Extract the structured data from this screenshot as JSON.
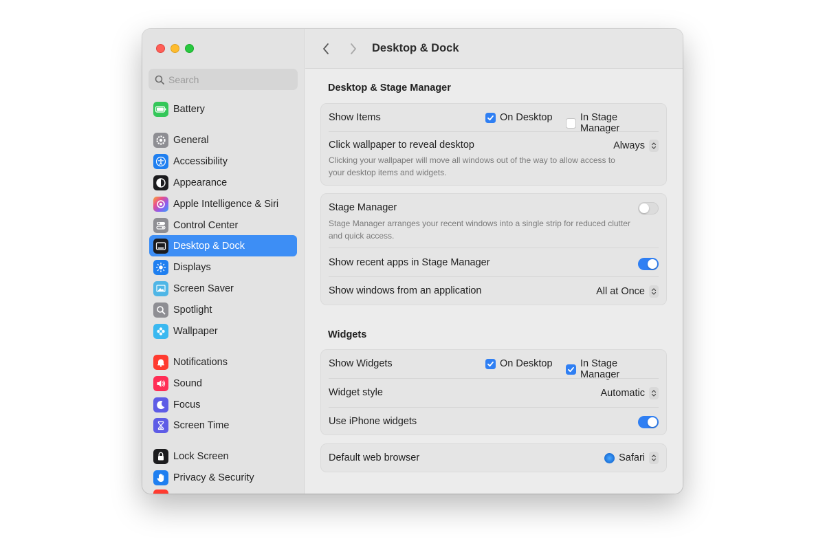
{
  "toolbar": {
    "title": "Desktop & Dock"
  },
  "search": {
    "placeholder": "Search"
  },
  "sidebar": {
    "items": [
      {
        "label": "Battery",
        "icon": "battery-icon",
        "color": "#34c759"
      },
      {
        "label": "General",
        "icon": "gear-icon",
        "color": "#8e8e93"
      },
      {
        "label": "Accessibility",
        "icon": "accessibility-icon",
        "color": "#1f7ff0"
      },
      {
        "label": "Appearance",
        "icon": "appearance-icon",
        "color": "#1c1c1e"
      },
      {
        "label": "Apple Intelligence & Siri",
        "icon": "siri-icon",
        "color": "#c86dd7"
      },
      {
        "label": "Control Center",
        "icon": "control-center-icon",
        "color": "#8e8e93"
      },
      {
        "label": "Desktop & Dock",
        "icon": "dock-icon",
        "color": "#1c1c1e",
        "selected": true
      },
      {
        "label": "Displays",
        "icon": "displays-icon",
        "color": "#1f7ff0"
      },
      {
        "label": "Screen Saver",
        "icon": "screen-saver-icon",
        "color": "#4fb6e6"
      },
      {
        "label": "Spotlight",
        "icon": "spotlight-icon",
        "color": "#8e8e93"
      },
      {
        "label": "Wallpaper",
        "icon": "wallpaper-icon",
        "color": "#3ab8f0"
      },
      {
        "label": "Notifications",
        "icon": "notifications-icon",
        "color": "#ff3b30"
      },
      {
        "label": "Sound",
        "icon": "sound-icon",
        "color": "#ff2d55"
      },
      {
        "label": "Focus",
        "icon": "focus-icon",
        "color": "#5e5ce6"
      },
      {
        "label": "Screen Time",
        "icon": "screen-time-icon",
        "color": "#5e5ce6"
      },
      {
        "label": "Lock Screen",
        "icon": "lock-icon",
        "color": "#1c1c1e"
      },
      {
        "label": "Privacy & Security",
        "icon": "hand-icon",
        "color": "#1f7ff0"
      }
    ]
  },
  "desktop_stage": {
    "title": "Desktop & Stage Manager",
    "show_items": {
      "label": "Show Items",
      "on_desktop": "On Desktop",
      "in_stage_manager": "In Stage Manager",
      "on_desktop_checked": true,
      "in_stage_manager_checked": false
    },
    "click_wallpaper": {
      "label": "Click wallpaper to reveal desktop",
      "value": "Always",
      "description": "Clicking your wallpaper will move all windows out of the way to allow access to your desktop items and widgets."
    },
    "stage_manager": {
      "label": "Stage Manager",
      "enabled": false,
      "description": "Stage Manager arranges your recent windows into a single strip for reduced clutter and quick access."
    },
    "show_recent_apps": {
      "label": "Show recent apps in Stage Manager",
      "enabled": true
    },
    "show_windows": {
      "label": "Show windows from an application",
      "value": "All at Once"
    }
  },
  "widgets": {
    "title": "Widgets",
    "show_widgets": {
      "label": "Show Widgets",
      "on_desktop": "On Desktop",
      "in_stage_manager": "In Stage Manager",
      "on_desktop_checked": true,
      "in_stage_manager_checked": true
    },
    "widget_style": {
      "label": "Widget style",
      "value": "Automatic"
    },
    "iphone_widgets": {
      "label": "Use iPhone widgets",
      "enabled": true
    }
  },
  "browser": {
    "label": "Default web browser",
    "value": "Safari"
  },
  "colors": {
    "accent": "#2f7ff3",
    "selection": "#3d8ef5"
  }
}
